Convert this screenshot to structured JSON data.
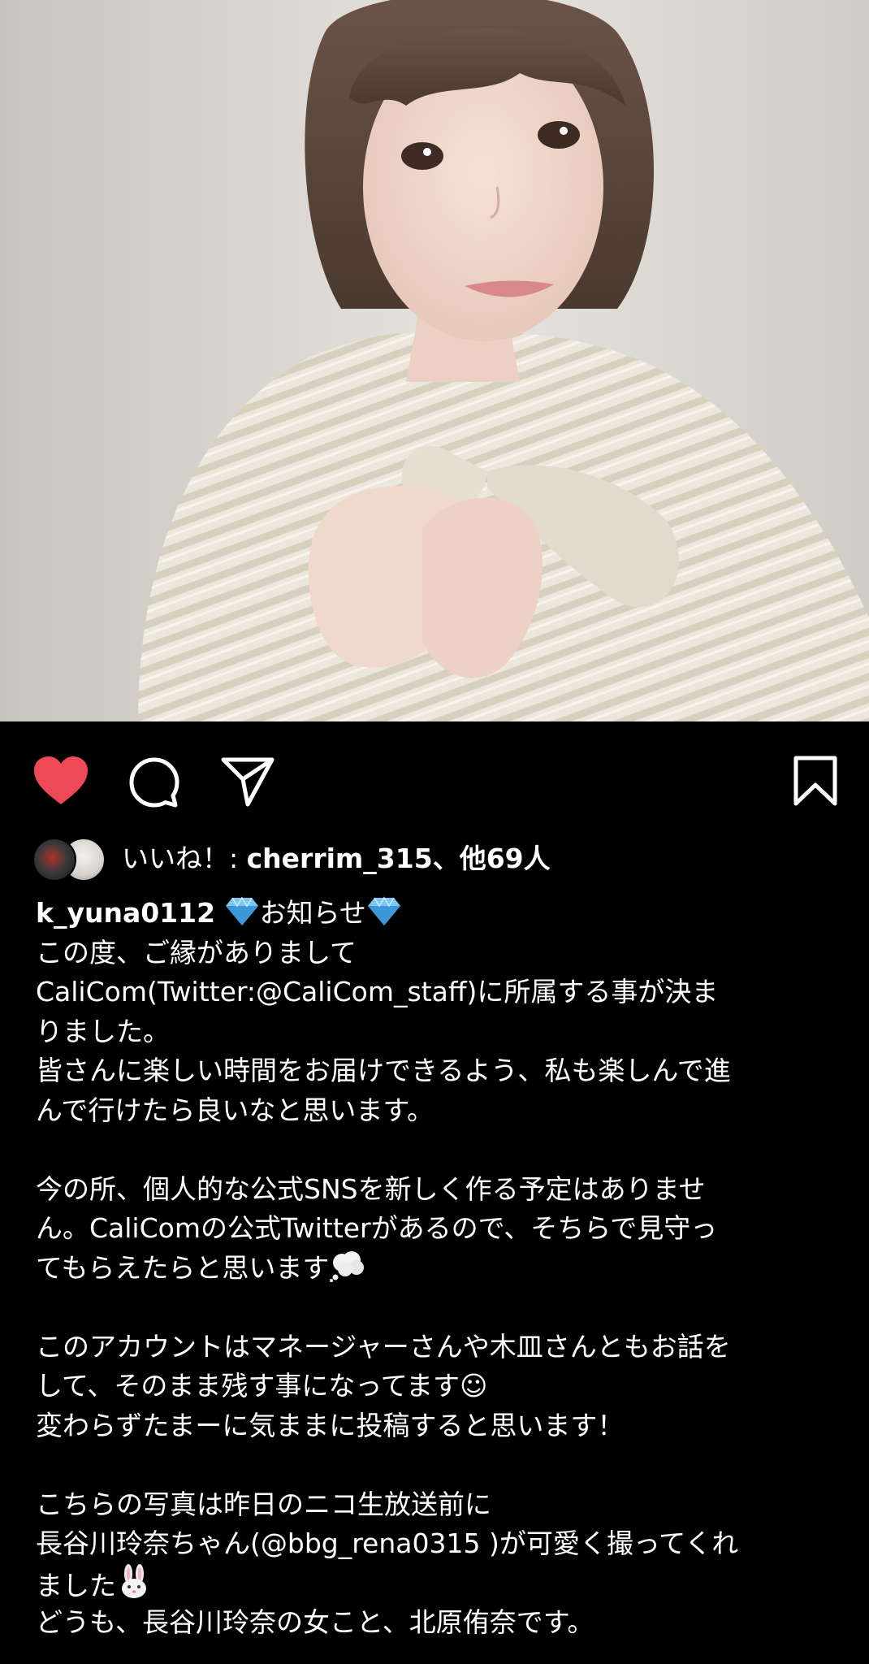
{
  "post": {
    "photo_alt": "photo",
    "liked": true,
    "colors": {
      "heart": "#ed4956",
      "text": "#ffffff",
      "background": "#000000"
    },
    "icons": [
      "heart-icon",
      "comment-icon",
      "share-icon",
      "bookmark-icon"
    ]
  },
  "likes": {
    "prefix": "いいね！: ",
    "user": "cherrim_315",
    "suffix": "、他69人"
  },
  "caption": {
    "username": "k_yuna0112",
    "heading": "お知らせ",
    "lines": [
      "この度、ご縁がありまして",
      "CaliCom(Twitter:@CaliCom_staff)に所属する事が決ま",
      "りました。",
      "皆さんに楽しい時間をお届けできるよう、私も楽しんで進",
      "んで行けたら良いなと思います。",
      "",
      "今の所、個人的な公式SNSを新しく作る予定はありませ",
      "ん。CaliComの公式Twitterがあるので、そちらで見守っ",
      "てもらえたらと思います",
      "",
      "このアカウントはマネージャーさんや木皿さんともお話を",
      "して、そのまま残す事になってます☺︎",
      "変わらずたまーに気ままに投稿すると思います！",
      "",
      "こちらの写真は昨日のニコ生放送前に",
      "長谷川玲奈ちゃん(@bbg_rena0315 )が可愛く撮ってくれ",
      "ました",
      "どうも、長谷川玲奈の女こと、北原侑奈です。"
    ]
  }
}
